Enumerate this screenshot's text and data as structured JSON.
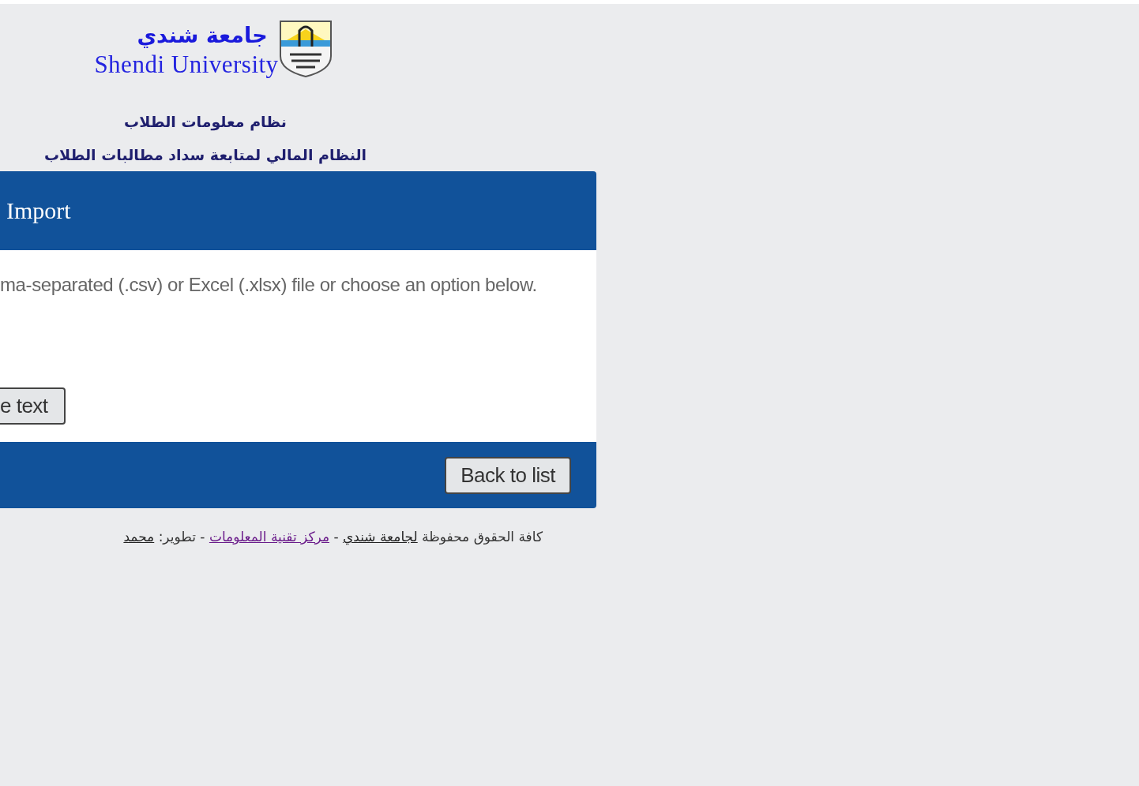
{
  "header": {
    "logo_arabic": "جامعة شندي",
    "logo_english": "Shendi University",
    "system_title": "نظام معلومات الطلاب",
    "subsystem_title": "النظام المالي لمتابعة سداد مطالبات  الطلاب"
  },
  "panel": {
    "title": "Import",
    "description": "ma-separated (.csv) or Excel (.xlsx) file or choose an option below.",
    "body_button": "e text",
    "footer_button": "Back to list"
  },
  "footer": [
    {
      "kind": "text",
      "text": "كافة الحقوق محفوظة "
    },
    {
      "kind": "link",
      "text": "لجامعة شندي",
      "visited": false
    },
    {
      "kind": "text",
      "text": " - "
    },
    {
      "kind": "link",
      "text": "مركز تقنية المعلومات",
      "visited": true
    },
    {
      "kind": "text",
      "text": " - تطوير: "
    },
    {
      "kind": "link",
      "text": "محمد",
      "visited": false
    }
  ]
}
